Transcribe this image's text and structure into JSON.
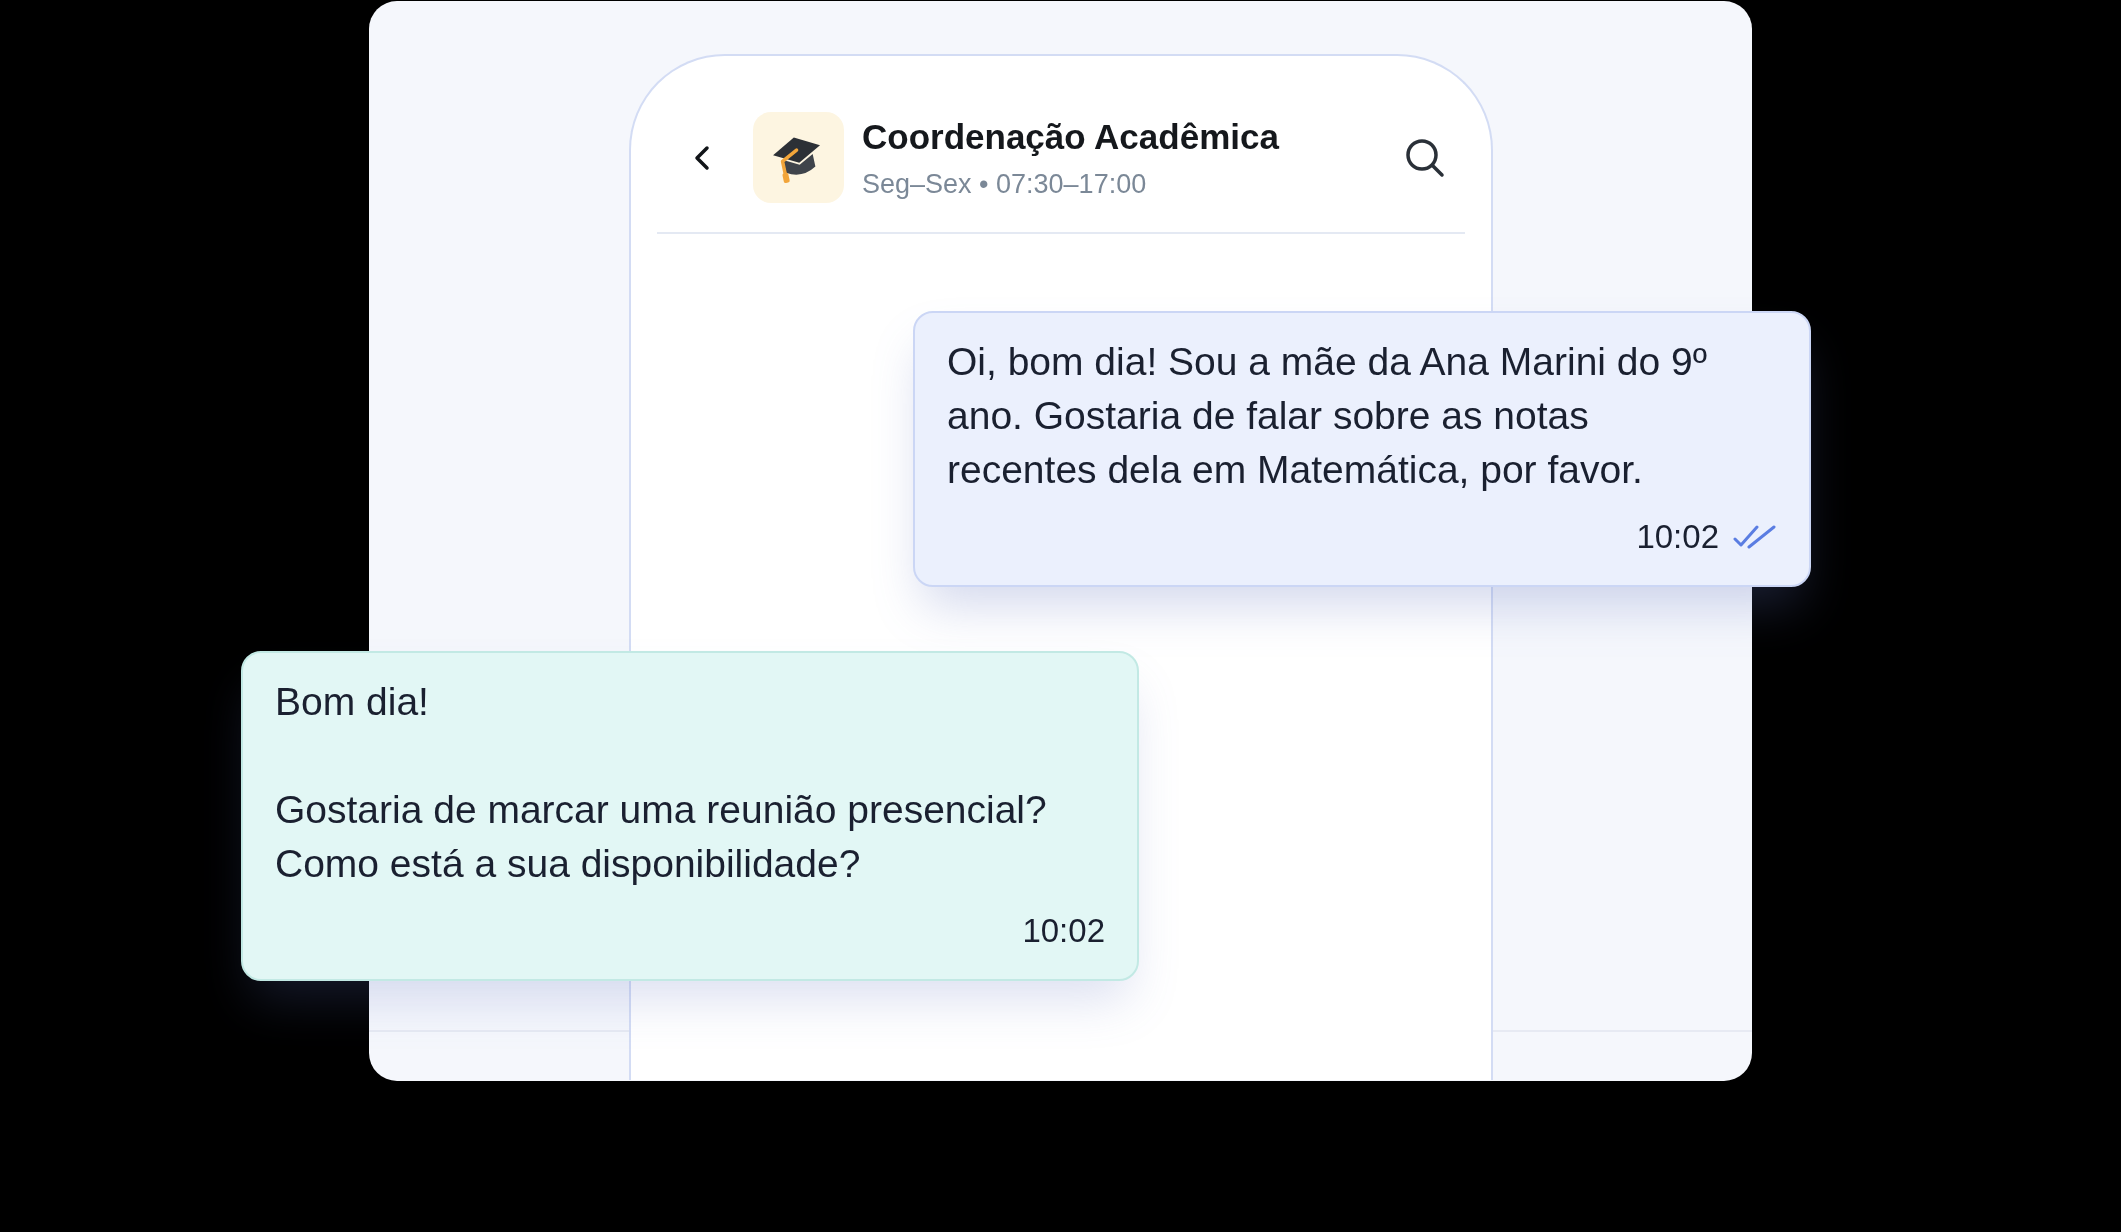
{
  "chat": {
    "header": {
      "title": "Coordenação Acadêmica",
      "subtitle": "Seg–Sex • 07:30–17:00"
    },
    "messages": [
      {
        "kind": "sent",
        "text": "Oi, bom dia! Sou a mãe da Ana Marini do 9º ano. Gostaria de falar sobre as notas recentes dela em Matemática, por favor.",
        "time": "10:02",
        "read": true
      },
      {
        "kind": "received",
        "text": "Bom dia!\n\nGostaria de marcar uma reunião presencial?\nComo está a sua disponibilidade?",
        "time": "10:02"
      }
    ]
  }
}
